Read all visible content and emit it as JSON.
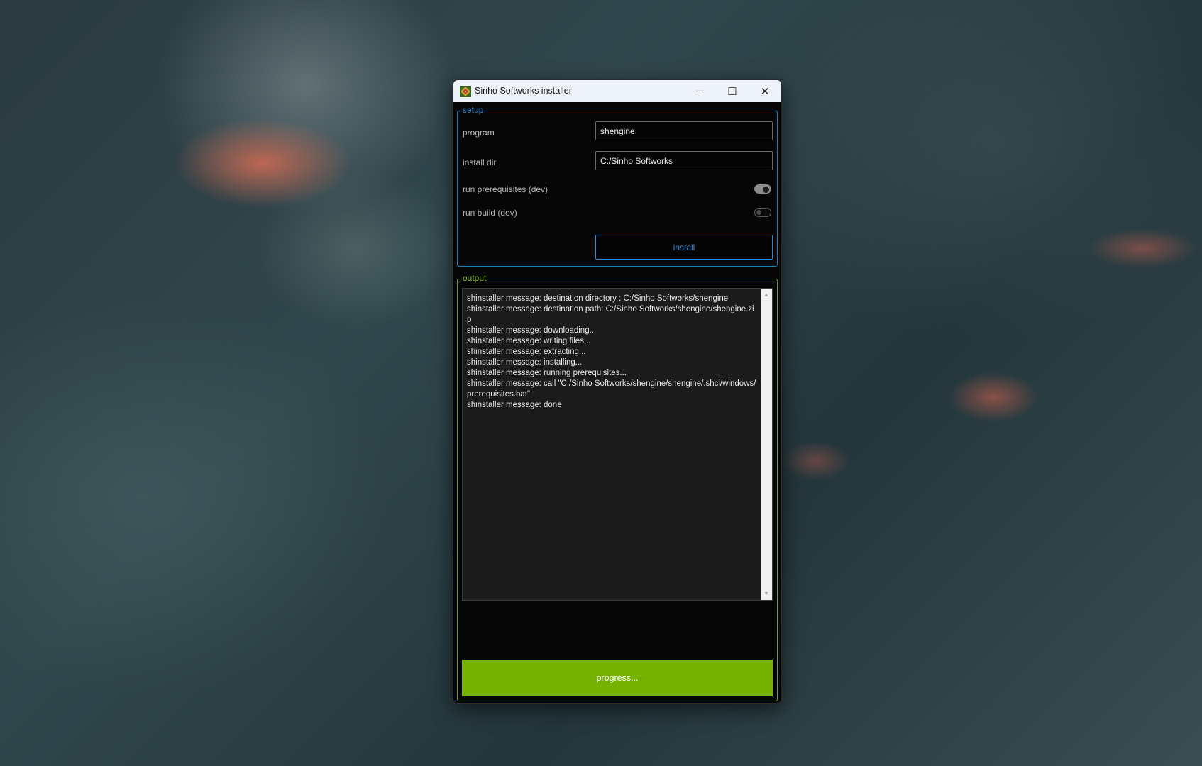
{
  "window": {
    "title": "Sinho Softworks installer",
    "icon": "app-icon",
    "controls": {
      "minimize": "─",
      "maximize": "☐",
      "close": "✕"
    }
  },
  "setup": {
    "group_label": "setup",
    "program_label": "program",
    "program_value": "shengine",
    "install_dir_label": "install dir",
    "install_dir_value": "C:/Sinho Softworks",
    "run_prerequisites_label": "run prerequisites (dev)",
    "run_prerequisites_on": true,
    "run_build_label": "run build (dev)",
    "run_build_on": false,
    "install_button": "install"
  },
  "output": {
    "group_label": "output",
    "lines": [
      "shinstaller message: destination directory : C:/Sinho Softworks/shengine",
      "shinstaller message: destination path: C:/Sinho Softworks/shengine/shengine.zip",
      "shinstaller message: downloading...",
      "shinstaller message: writing files...",
      "shinstaller message: extracting...",
      "shinstaller message: installing...",
      "shinstaller message: running prerequisites...",
      "shinstaller message: call \"C:/Sinho Softworks/shengine/shengine/.shci/windows/prerequisites.bat\"",
      "shinstaller message: done"
    ],
    "progress_text": "progress..."
  },
  "colors": {
    "setup_accent": "#2a8fd6",
    "output_accent": "#82b924",
    "progress_fill": "#76b300"
  }
}
